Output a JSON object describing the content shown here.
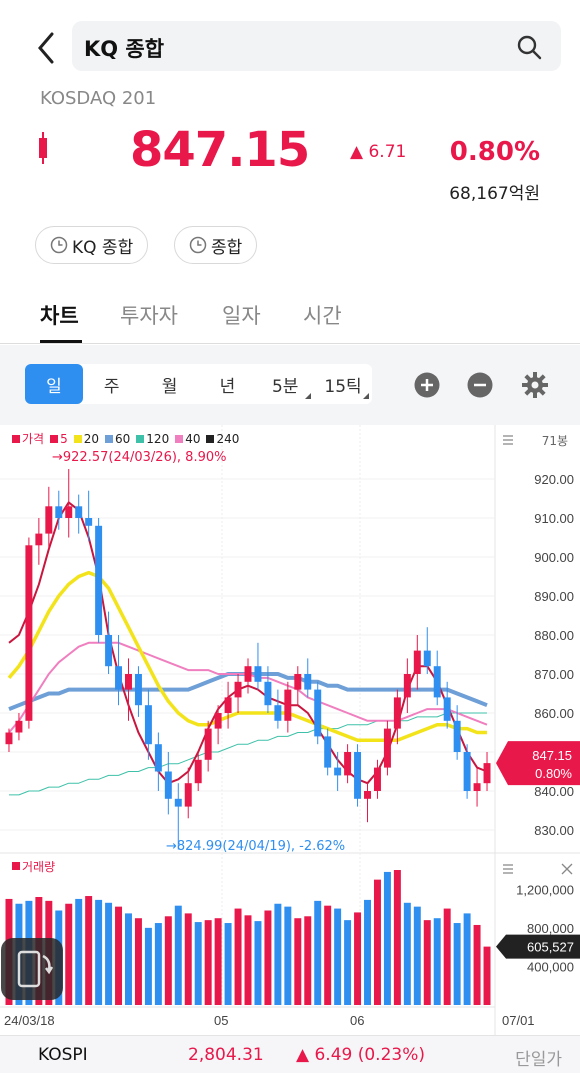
{
  "header": {
    "search_text": "KQ 종합",
    "subtitle": "KOSDAQ 201",
    "price": "847.15",
    "change": "▲ 6.71",
    "change_pct": "0.80%",
    "trade_amount": "68,167억원"
  },
  "chips": [
    "KQ 종합",
    "종합"
  ],
  "tabs": [
    "차트",
    "투자자",
    "일자",
    "시간"
  ],
  "periods": [
    "일",
    "주",
    "월",
    "년",
    "5분",
    "15틱"
  ],
  "legend": [
    {
      "label": "가격",
      "color": "#e8184b"
    },
    {
      "label": "5",
      "color": "#e8184b"
    },
    {
      "label": "20",
      "color": "#f2e31b"
    },
    {
      "label": "60",
      "color": "#6e9fd6"
    },
    {
      "label": "120",
      "color": "#3ec1a8"
    },
    {
      "label": "40",
      "color": "#f07fbf"
    },
    {
      "label": "240",
      "color": "#222222"
    }
  ],
  "chart_data": {
    "type": "candlestick",
    "max_annotation": "→922.57(24/03/26), 8.90%",
    "min_annotation": "→824.99(24/04/19), -2.62%",
    "y_ticks": [
      "920.00",
      "910.00",
      "900.00",
      "890.00",
      "880.00",
      "870.00",
      "860.00",
      "850.00",
      "840.00",
      "830.00"
    ],
    "ylim": [
      826,
      928
    ],
    "current_label": "847.15",
    "current_pct": "0.80%",
    "bars_label": "71봉",
    "x_ticks": [
      "24/03/18",
      "05",
      "06",
      "07/01"
    ],
    "volume_title": "거래량",
    "volume_ticks": [
      "1,200,000",
      "800,000",
      "400,000"
    ],
    "volume_current": "605,527",
    "volume_ylim": [
      0,
      1400000
    ],
    "candles": [
      [
        852,
        856,
        850,
        855
      ],
      [
        855,
        860,
        853,
        858
      ],
      [
        858,
        905,
        856,
        903
      ],
      [
        903,
        910,
        898,
        906
      ],
      [
        906,
        918,
        902,
        913
      ],
      [
        913,
        917,
        907,
        910
      ],
      [
        910,
        922.57,
        905,
        913
      ],
      [
        913,
        916,
        906,
        910
      ],
      [
        910,
        917,
        904,
        908
      ],
      [
        908,
        910,
        878,
        880
      ],
      [
        880,
        886,
        870,
        872
      ],
      [
        872,
        880,
        862,
        866
      ],
      [
        866,
        874,
        858,
        870
      ],
      [
        870,
        872,
        859,
        862
      ],
      [
        862,
        866,
        848,
        852
      ],
      [
        852,
        855,
        840,
        845
      ],
      [
        845,
        850,
        834,
        838
      ],
      [
        838,
        842,
        824.99,
        836
      ],
      [
        836,
        846,
        833,
        842
      ],
      [
        842,
        850,
        840,
        848
      ],
      [
        848,
        858,
        845,
        856
      ],
      [
        856,
        862,
        852,
        860
      ],
      [
        860,
        868,
        856,
        864
      ],
      [
        864,
        870,
        860,
        868
      ],
      [
        868,
        874,
        865,
        872
      ],
      [
        872,
        878,
        866,
        868
      ],
      [
        868,
        872,
        860,
        862
      ],
      [
        862,
        866,
        856,
        858
      ],
      [
        858,
        868,
        855,
        866
      ],
      [
        866,
        872,
        862,
        870
      ],
      [
        870,
        874,
        864,
        866
      ],
      [
        866,
        868,
        852,
        854
      ],
      [
        854,
        856,
        844,
        846
      ],
      [
        846,
        850,
        840,
        844
      ],
      [
        844,
        852,
        842,
        850
      ],
      [
        850,
        852,
        836,
        838
      ],
      [
        838,
        842,
        832,
        840
      ],
      [
        840,
        848,
        838,
        846
      ],
      [
        846,
        858,
        844,
        856
      ],
      [
        856,
        866,
        852,
        864
      ],
      [
        864,
        874,
        860,
        870
      ],
      [
        870,
        880,
        866,
        876
      ],
      [
        876,
        882,
        870,
        872
      ],
      [
        872,
        876,
        862,
        864
      ],
      [
        864,
        868,
        856,
        858
      ],
      [
        858,
        862,
        848,
        850
      ],
      [
        850,
        852,
        838,
        840
      ],
      [
        840,
        846,
        836,
        842
      ],
      [
        842,
        850,
        840,
        847.15
      ]
    ],
    "ma5": [
      878,
      880,
      886,
      893,
      902,
      910,
      914,
      912,
      905,
      895,
      880,
      870,
      862,
      855,
      850,
      845,
      842,
      843,
      845,
      850,
      856,
      861,
      864,
      866,
      867,
      866,
      864,
      863,
      862,
      862,
      860,
      856,
      852,
      848,
      845,
      843,
      842,
      845,
      850,
      857,
      866,
      872,
      872,
      868,
      862,
      856,
      850,
      846,
      845
    ],
    "ma20": [
      869,
      872,
      876,
      881,
      886,
      890,
      893,
      895,
      896,
      895,
      892,
      887,
      882,
      877,
      872,
      867,
      863,
      860,
      858,
      857,
      857,
      858,
      859,
      860,
      860,
      860,
      860,
      860,
      860,
      859,
      858,
      857,
      856,
      855,
      854,
      853,
      853,
      853,
      853,
      853,
      854,
      855,
      856,
      857,
      857,
      856,
      856,
      855,
      855
    ],
    "ma40": [
      855,
      858,
      862,
      866,
      870,
      873,
      875,
      877,
      878,
      878,
      878,
      878,
      877,
      876,
      875,
      874,
      873,
      872,
      871,
      871,
      871,
      870,
      870,
      870,
      870,
      869,
      869,
      868,
      867,
      866,
      864,
      863,
      862,
      861,
      860,
      859,
      858,
      858,
      858,
      858,
      859,
      860,
      861,
      861,
      861,
      860,
      859,
      858,
      857
    ],
    "ma60": [
      861,
      862,
      863,
      864,
      865,
      865,
      866,
      866,
      866,
      866,
      866,
      866,
      866,
      866,
      866,
      866,
      866,
      866,
      866,
      867,
      868,
      869,
      870,
      870,
      870,
      870,
      870,
      870,
      869,
      869,
      868,
      868,
      867,
      867,
      866,
      866,
      866,
      866,
      866,
      866,
      866,
      866,
      866,
      866,
      866,
      865,
      864,
      863,
      862
    ],
    "ma120": [
      839,
      839,
      840,
      840,
      841,
      841,
      842,
      842,
      843,
      843,
      844,
      844,
      845,
      845,
      846,
      846,
      847,
      847,
      848,
      849,
      850,
      850,
      851,
      852,
      852,
      853,
      853,
      854,
      854,
      855,
      855,
      856,
      856,
      856,
      857,
      857,
      857,
      858,
      858,
      858,
      858,
      859,
      859,
      859,
      860,
      860,
      860,
      860,
      860
    ],
    "volumes": [
      1100000,
      1050000,
      1080000,
      1120000,
      1080000,
      980000,
      1050000,
      1100000,
      1130000,
      1090000,
      1060000,
      1020000,
      950000,
      900000,
      800000,
      850000,
      920000,
      1030000,
      950000,
      860000,
      880000,
      900000,
      850000,
      1000000,
      930000,
      870000,
      980000,
      1050000,
      1020000,
      900000,
      920000,
      1080000,
      1030000,
      1000000,
      880000,
      960000,
      1090000,
      1300000,
      1380000,
      1400000,
      1060000,
      1020000,
      880000,
      900000,
      1000000,
      850000,
      950000,
      830000,
      605527
    ],
    "volume_colors": [
      "r",
      "b",
      "b",
      "r",
      "r",
      "b",
      "r",
      "b",
      "r",
      "b",
      "b",
      "r",
      "b",
      "r",
      "b",
      "b",
      "r",
      "b",
      "r",
      "b",
      "r",
      "r",
      "b",
      "r",
      "r",
      "b",
      "r",
      "b",
      "b",
      "r",
      "r",
      "b",
      "r",
      "b",
      "b",
      "r",
      "b",
      "r",
      "b",
      "r",
      "b",
      "b",
      "r",
      "b",
      "r",
      "b",
      "b",
      "r",
      "r"
    ]
  },
  "bottom_bar": {
    "index_name": "KOSPI",
    "index_price": "2,804.31",
    "index_change": "▲ 6.49 (0.23%)",
    "unit_label": "단일가"
  }
}
